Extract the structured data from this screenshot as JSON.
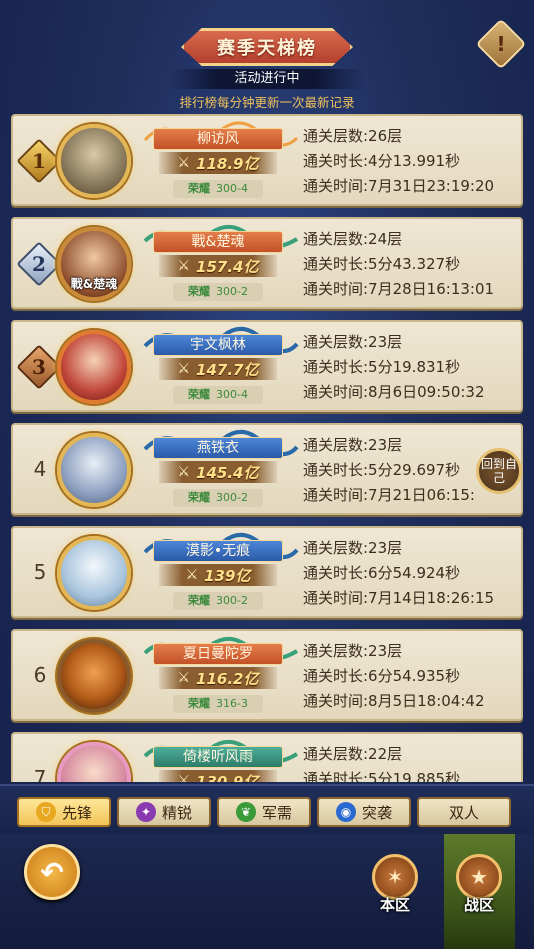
{
  "header": {
    "title": "赛季天梯榜",
    "status": "活动进行中",
    "note": "排行榜每分钟更新一次最新记录",
    "info_icon": "exclamation-icon"
  },
  "entries": [
    {
      "rank": "1",
      "name": "柳访风",
      "power": "118.9亿",
      "honor_label": "荣耀",
      "honor_value": "300-4",
      "floors": "通关层数:26层",
      "duration": "通关时长:4分13.991秒",
      "time": "通关时间:7月31日23:19:20"
    },
    {
      "rank": "2",
      "avatar_tag": "戰&楚魂",
      "name": "戰&楚魂",
      "power": "157.4亿",
      "honor_label": "荣耀",
      "honor_value": "300-2",
      "floors": "通关层数:24层",
      "duration": "通关时长:5分43.327秒",
      "time": "通关时间:7月28日16:13:01"
    },
    {
      "rank": "3",
      "name": "宇文枫林",
      "power": "147.7亿",
      "honor_label": "荣耀",
      "honor_value": "300-4",
      "floors": "通关层数:23层",
      "duration": "通关时长:5分19.831秒",
      "time": "通关时间:8月6日09:50:32"
    },
    {
      "rank": "4",
      "name": "燕铁衣",
      "power": "145.4亿",
      "honor_label": "荣耀",
      "honor_value": "300-2",
      "floors": "通关层数:23层",
      "duration": "通关时长:5分29.697秒",
      "time": "通关时间:7月21日06:15:"
    },
    {
      "rank": "5",
      "name": "漠影•无痕",
      "power": "139亿",
      "honor_label": "荣耀",
      "honor_value": "300-2",
      "floors": "通关层数:23层",
      "duration": "通关时长:6分54.924秒",
      "time": "通关时间:7月14日18:26:15"
    },
    {
      "rank": "6",
      "name": "夏日曼陀罗",
      "power": "116.2亿",
      "honor_label": "荣耀",
      "honor_value": "316-3",
      "floors": "通关层数:23层",
      "duration": "通关时长:6分54.935秒",
      "time": "通关时间:8月5日18:04:42"
    },
    {
      "rank": "7",
      "name": "倚楼听风雨",
      "power": "130.9亿",
      "honor_label": "",
      "honor_value": "",
      "floors": "通关层数:22层",
      "duration": "通关时长:5分19.885秒",
      "time": ""
    }
  ],
  "back_to_self": "回到自己",
  "tabs": [
    {
      "label": "先锋",
      "icon": "shield-icon",
      "active": true
    },
    {
      "label": "精锐",
      "icon": "swirl-icon",
      "active": false
    },
    {
      "label": "军需",
      "icon": "leaf-icon",
      "active": false
    },
    {
      "label": "突袭",
      "icon": "vortex-icon",
      "active": false
    },
    {
      "label": "双人",
      "icon": "",
      "active": false
    }
  ],
  "bottom": {
    "back_icon": "return-arrow-icon",
    "local_server": "本区",
    "war_zone": "战区"
  },
  "colors": {
    "background": "#1e2d5a",
    "card": "#efe7d4",
    "accent_gold": "#f0c25a",
    "title_red": "#c35128",
    "honor_green": "#3d8a3d"
  }
}
